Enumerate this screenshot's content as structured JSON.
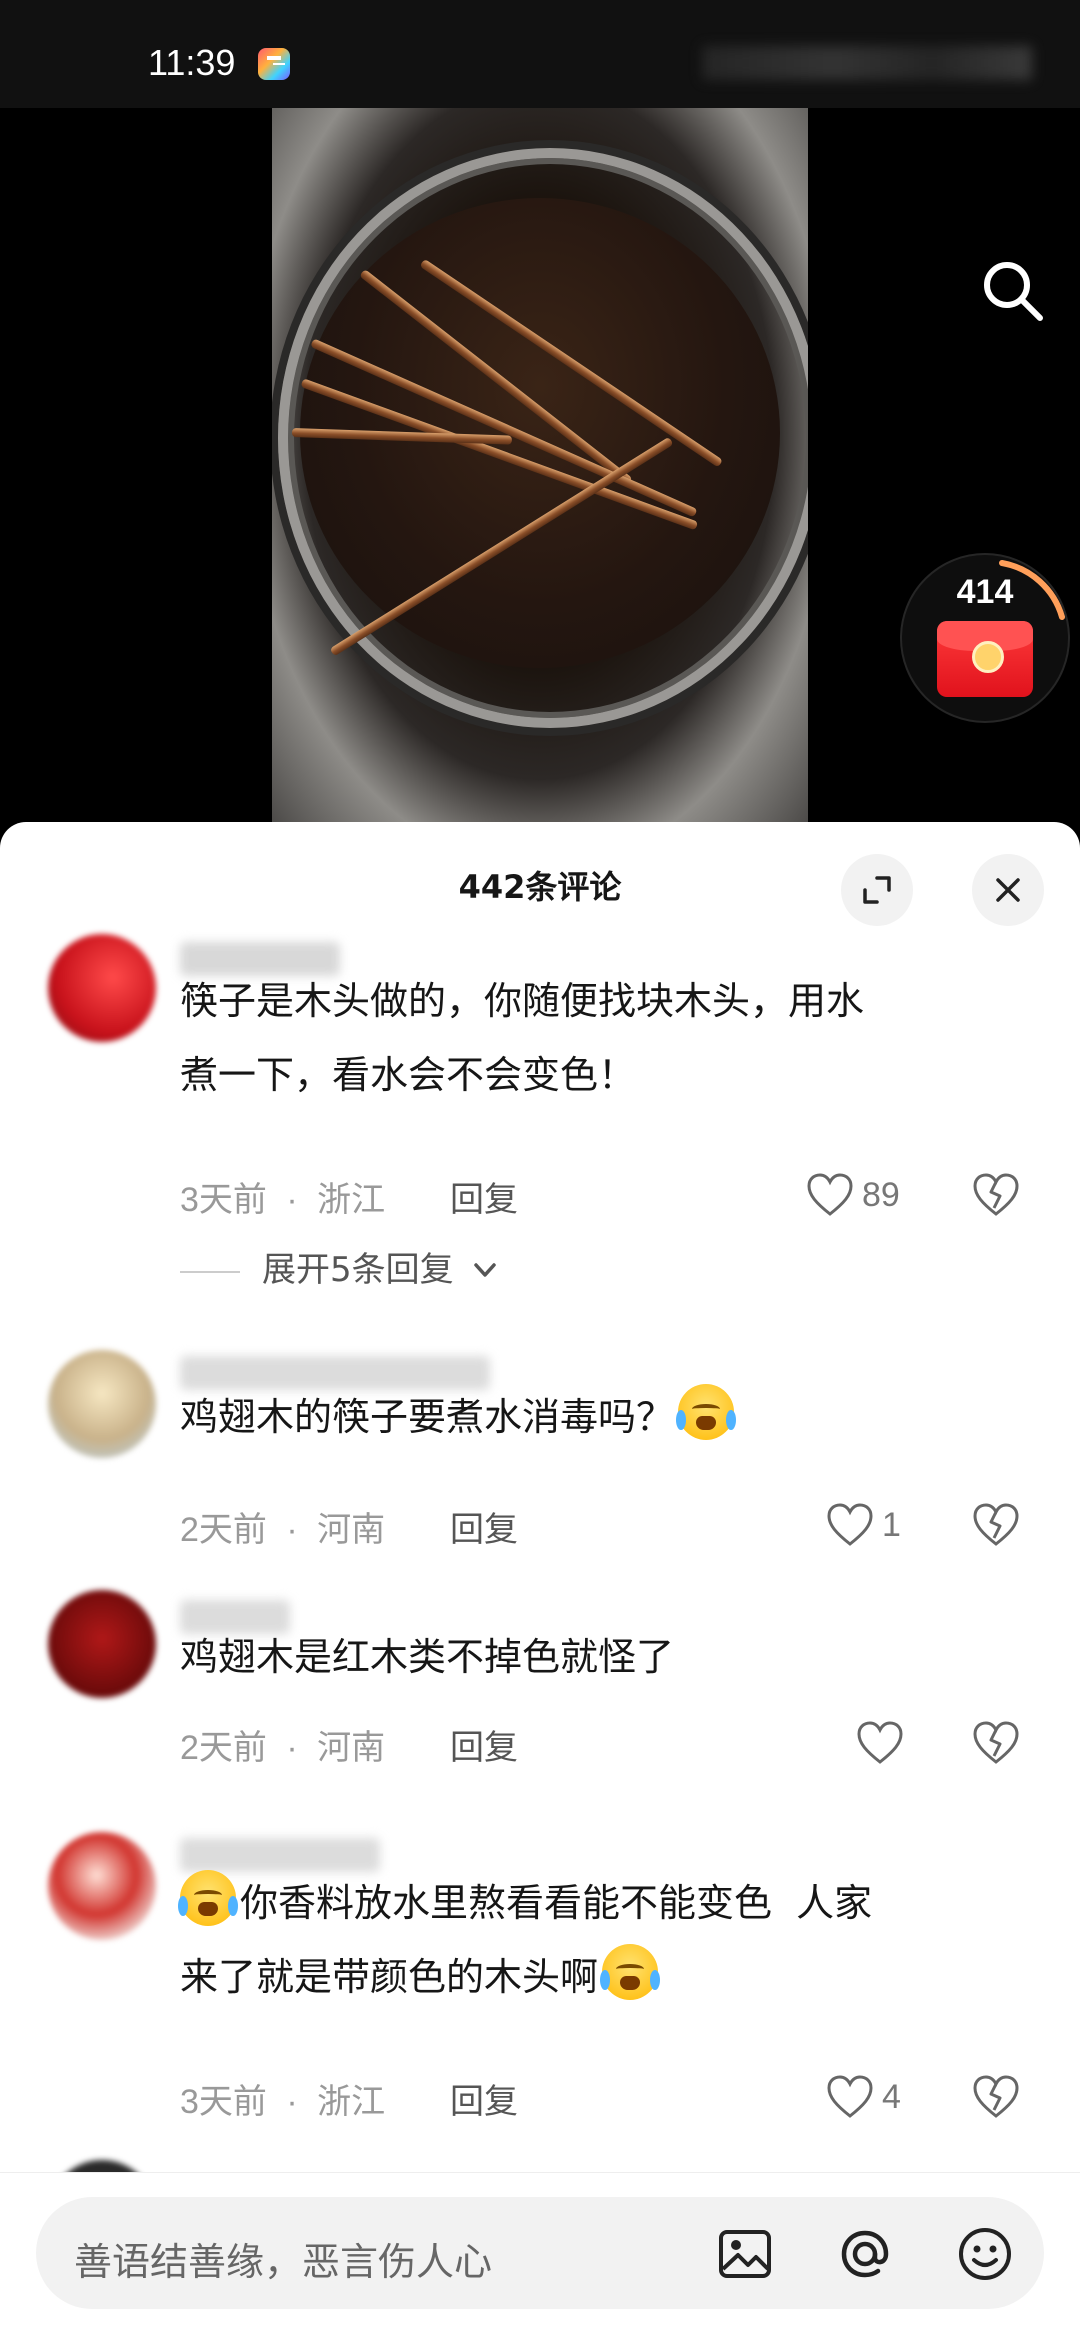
{
  "status_bar": {
    "time": "11:39"
  },
  "video": {
    "redpacket_count": "414"
  },
  "comments_panel": {
    "title": "442条评论",
    "comments": [
      {
        "text_lines": [
          "筷子是木头做的，你随便找块木头，用水",
          "煮一下，看水会不会变色！"
        ],
        "time": "3天前",
        "location": "浙江",
        "reply_label": "回复",
        "likes": "89",
        "expand_label": "展开5条回复"
      },
      {
        "text": "鸡翅木的筷子要煮水消毒吗？",
        "time": "2天前",
        "location": "河南",
        "reply_label": "回复",
        "likes": "1"
      },
      {
        "text": "鸡翅木是红木类不掉色就怪了",
        "time": "2天前",
        "location": "河南",
        "reply_label": "回复",
        "likes": ""
      },
      {
        "text_line1": "你香料放水里熬看看能不能变色  人家",
        "text_line2": "来了就是带颜色的木头啊",
        "time": "3天前",
        "location": "浙江",
        "reply_label": "回复",
        "likes": "4"
      }
    ],
    "separator": "·"
  },
  "input_bar": {
    "placeholder": "善语结善缘，恶言伤人心"
  },
  "colors": {
    "accent_red": "#e0121c",
    "sheet_bg": "#ffffff",
    "meta_gray": "#999999"
  },
  "icons": [
    "search-icon",
    "expand-icon",
    "close-icon",
    "heart-icon",
    "dislike-icon",
    "image-icon",
    "at-icon",
    "emoji-icon",
    "chevron-down-icon"
  ]
}
